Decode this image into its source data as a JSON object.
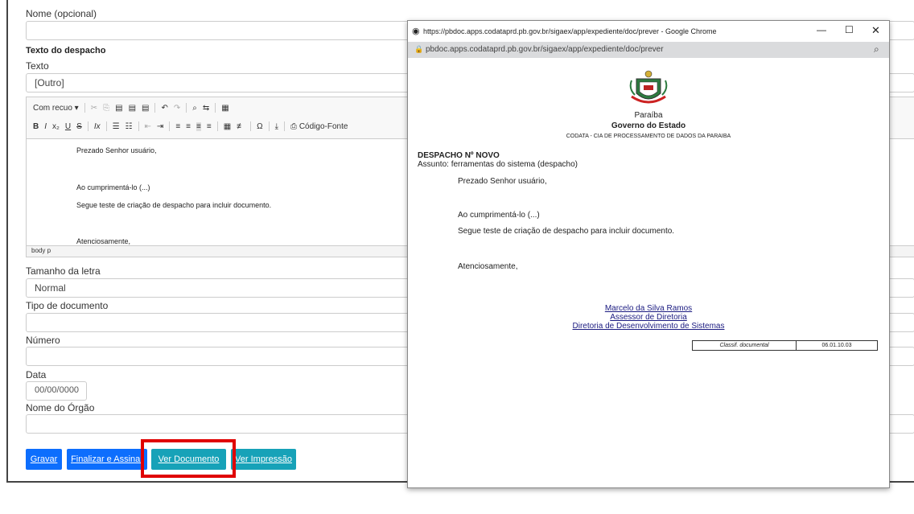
{
  "form": {
    "nome_label": "Nome (opcional)",
    "texto_despacho_title": "Texto do despacho",
    "texto_label": "Texto",
    "texto_select_value": "[Outro]",
    "toolbar": {
      "style_select": "Com recuo",
      "source_label": "Código-Fonte"
    },
    "editor_lines": [
      "Prezado Senhor usuário,",
      "Ao cumprimentá-lo (...)",
      "Segue teste de criação de despacho para incluir documento.",
      "Atenciosamente,"
    ],
    "path_bar": "body  p",
    "tamanho_label": "Tamanho da letra",
    "tamanho_value": "Normal",
    "tipo_label": "Tipo de documento",
    "numero_label": "Número",
    "data_label": "Data",
    "data_value": "00/00/0000",
    "orgao_label": "Nome do Órgão"
  },
  "buttons": {
    "gravar": "Gravar",
    "finalizar": "Finalizar e Assinar",
    "ver_documento": "Ver Documento",
    "ver_impressao": "Ver Impressão"
  },
  "popup": {
    "window_title": "https://pbdoc.apps.codataprd.pb.gov.br/sigaex/app/expediente/doc/prever - Google Chrome",
    "url": "pbdoc.apps.codataprd.pb.gov.br/sigaex/app/expediente/doc/prever",
    "doc": {
      "state": "Paraíba",
      "government": "Governo do Estado",
      "agency": "CODATA - CIA DE PROCESSAMENTO DE DADOS DA PARAIBA",
      "heading": "DESPACHO Nº NOVO",
      "subject": "Assunto: ferramentas do sistema (despacho)",
      "lines": [
        "Prezado Senhor usuário,",
        "Ao cumprimentá-lo (...)",
        "Segue teste de criação de despacho para incluir documento.",
        "Atenciosamente,"
      ],
      "signer_name": "Marcelo da Silva Ramos",
      "signer_role": "Assessor de Diretoria",
      "signer_dept": "Diretoria de Desenvolvimento de Sistemas",
      "classif_label": "Classif. documental",
      "classif_value": "06.01.10.03"
    }
  },
  "colors": {
    "primary": "#0d6efd",
    "teal": "#17a2b8",
    "highlight": "#e00000"
  }
}
